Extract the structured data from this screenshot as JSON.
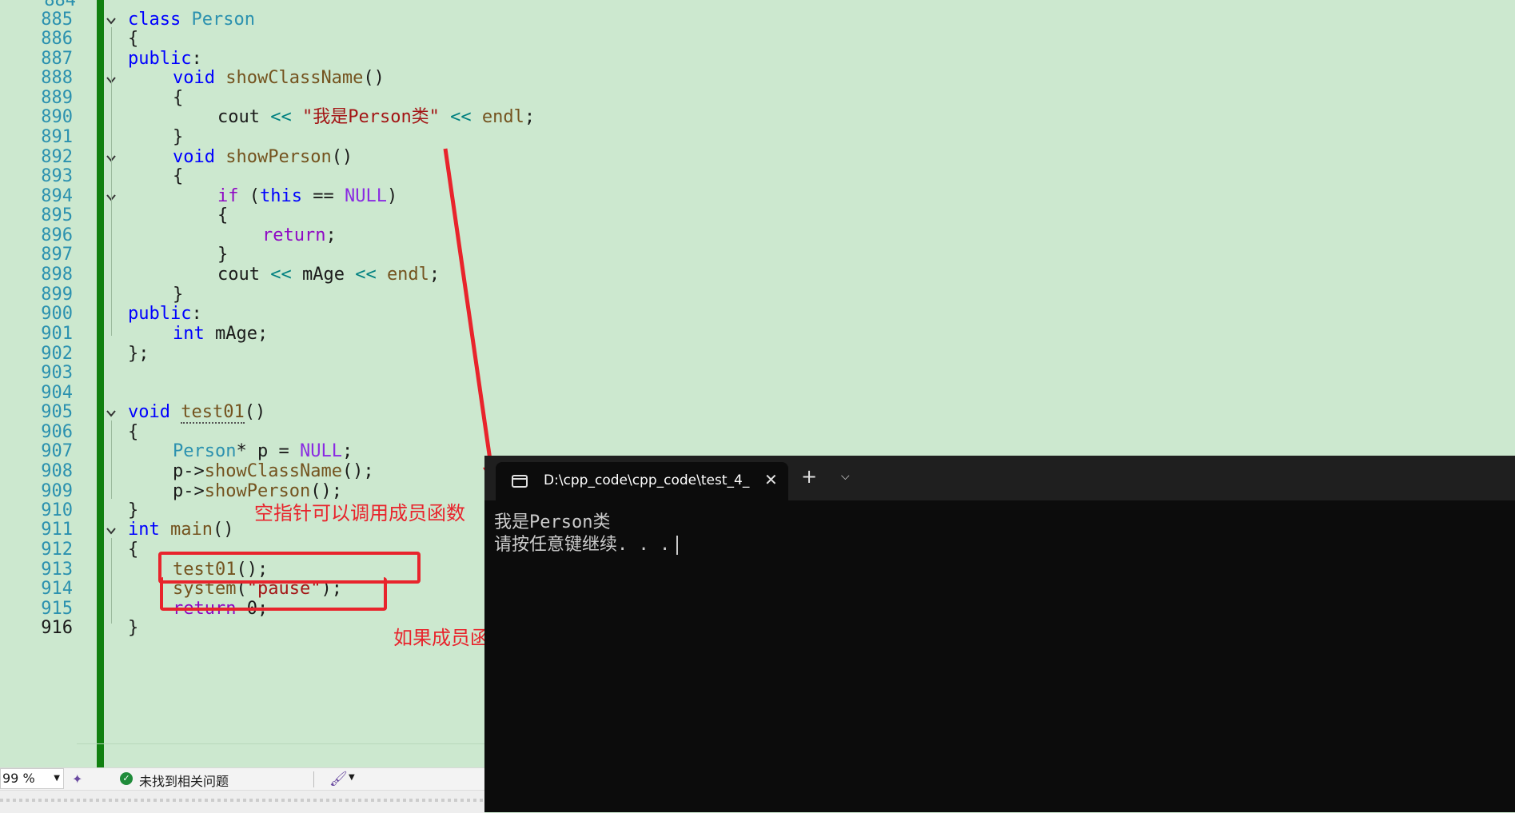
{
  "editor": {
    "top_partial_line": "884",
    "line_numbers": [
      "885",
      "886",
      "887",
      "888",
      "889",
      "890",
      "891",
      "892",
      "893",
      "894",
      "895",
      "896",
      "897",
      "898",
      "899",
      "900",
      "901",
      "902",
      "903",
      "904",
      "905",
      "906",
      "907",
      "908",
      "909",
      "910",
      "911",
      "912",
      "913",
      "914",
      "915",
      "916"
    ],
    "current_line": "916",
    "code": {
      "l885": [
        "class",
        " ",
        "Person"
      ],
      "l886": "{",
      "l887": [
        "public",
        ":"
      ],
      "l888": [
        "void",
        " ",
        "showClassName",
        "()"
      ],
      "l889": "{",
      "l890": [
        "cout",
        " << ",
        "\"我是Person类\"",
        " << ",
        "endl",
        ";"
      ],
      "l891": "}",
      "l892": [
        "void",
        " ",
        "showPerson",
        "()"
      ],
      "l893": "{",
      "l894": [
        "if",
        " (",
        "this",
        " == ",
        "NULL",
        ")"
      ],
      "l895": "{",
      "l896": [
        "return",
        ";"
      ],
      "l897": "}",
      "l898": [
        "cout",
        " << ",
        "mAge",
        " << ",
        "endl",
        ";"
      ],
      "l899": "}",
      "l900": [
        "public",
        ":"
      ],
      "l901": [
        "int",
        " mAge;"
      ],
      "l902": "};",
      "l905": [
        "void",
        " ",
        "test01",
        "()"
      ],
      "l906": "{",
      "l907": [
        "Person",
        "* p = ",
        "NULL",
        ";"
      ],
      "l908": [
        "p->",
        "showClassName",
        "();"
      ],
      "l909": [
        "p->",
        "showPerson",
        "();"
      ],
      "l910": "}",
      "l911": [
        "int",
        " ",
        "main",
        "()"
      ],
      "l912": "{",
      "l913": [
        "test01",
        "();"
      ],
      "l914": [
        "system",
        "(",
        "\"pause\"",
        ");"
      ],
      "l915": [
        "return",
        " 0;"
      ],
      "l916": "}"
    }
  },
  "annotations": {
    "note1": "空指针可以调用成员函数",
    "note2": "如果成员函数用到了this指针就不可以调用了"
  },
  "statusbar": {
    "zoom": "99 %",
    "issues": "未找到相关问题"
  },
  "terminal": {
    "tab_title": "D:\\cpp_code\\cpp_code\\test_4_",
    "output_line1": "我是Person类",
    "output_line2": "请按任意键继续. . ."
  },
  "colors": {
    "editor_bg": "#cce8cf",
    "keyword": "#0000ff",
    "type": "#2b91af",
    "function": "#74531f",
    "string": "#a31515",
    "annotation": "#e8242c",
    "terminal_bg": "#0c0c0c",
    "change_bar": "#108010"
  },
  "icons": {
    "fold": "chevron-down-icon",
    "status_ok": "check-circle-icon",
    "terminal": "terminal-icon",
    "close": "close-icon",
    "new_tab": "plus-icon",
    "dropdown": "chevron-down-icon",
    "cleanup": "brush-icon"
  }
}
